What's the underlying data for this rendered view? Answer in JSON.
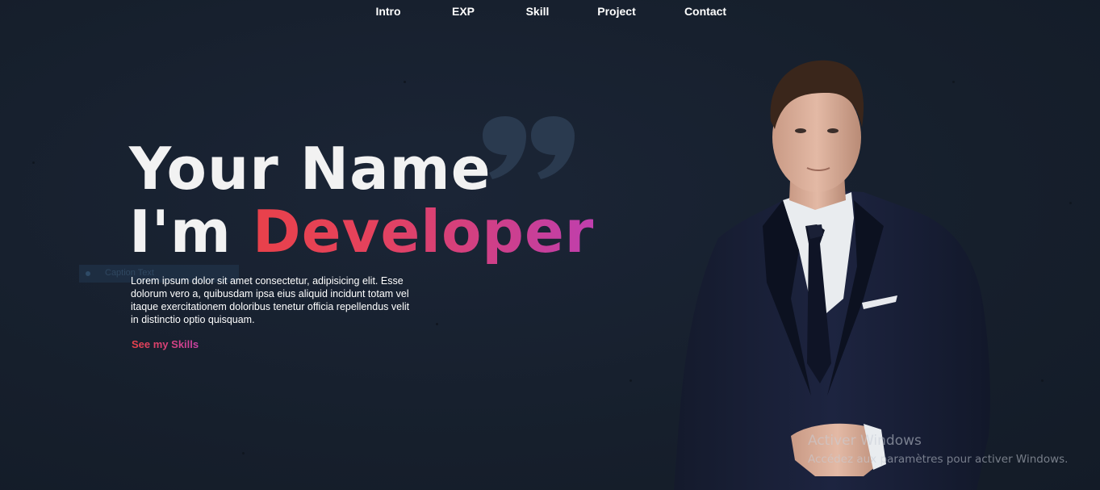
{
  "nav": {
    "items": [
      {
        "label": "Intro"
      },
      {
        "label": "EXP"
      },
      {
        "label": "Skill"
      },
      {
        "label": "Project"
      },
      {
        "label": "Contact"
      }
    ]
  },
  "hero": {
    "name_line": "Your Name",
    "role_prefix": "I'm ",
    "role": "Developer",
    "description": "Lorem ipsum dolor sit amet consectetur, adipisicing elit. Esse dolorum vero a, quibusdam ipsa eius aliquid incidunt totam vel itaque exercitationem doloribus tenetur officia repellendus velit in distinctio optio quisquam.",
    "cta_label": "See my Skills"
  },
  "ghost_caption": {
    "text": "Caption Text"
  },
  "watermark": {
    "title": "Activer Windows",
    "subtitle": "Accédez aux paramètres pour activer Windows."
  },
  "colors": {
    "background": "#17202e",
    "accent_start": "#e8414a",
    "accent_end": "#c03fae",
    "quote": "#2a3a4f"
  }
}
